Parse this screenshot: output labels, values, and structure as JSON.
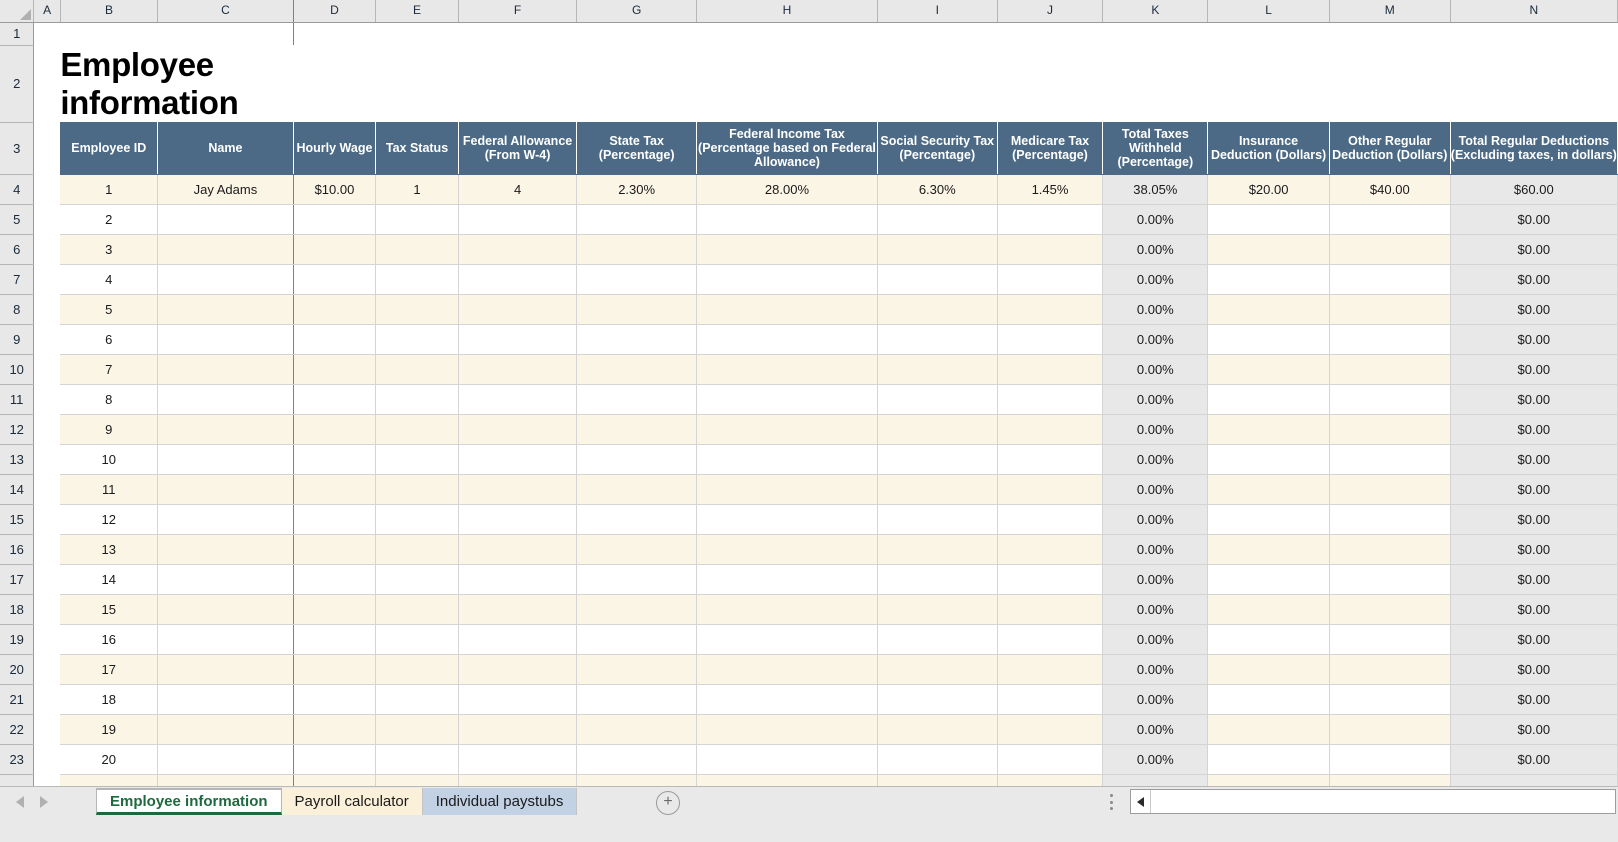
{
  "workbook": {
    "title": "Employee information"
  },
  "grid": {
    "column_letters": [
      "A",
      "B",
      "C",
      "D",
      "E",
      "F",
      "G",
      "H",
      "I",
      "J",
      "K",
      "L",
      "M",
      "N"
    ],
    "row_numbers": [
      "1",
      "2",
      "3",
      "4",
      "5",
      "6",
      "7",
      "8",
      "9",
      "10",
      "11",
      "12",
      "13",
      "14",
      "15",
      "16",
      "17",
      "18",
      "19",
      "20",
      "21",
      "22",
      "23"
    ],
    "corner_icon": "select-all-triangle-icon"
  },
  "sheet_title": "Employee information",
  "table": {
    "headers": [
      "Employee ID",
      "Name",
      "Hourly Wage",
      "Tax  Status",
      "Federal Allowance (From W-4)",
      "State Tax (Percentage)",
      "Federal Income Tax (Percentage based on Federal Allowance)",
      "Social Security Tax (Percentage)",
      "Medicare Tax (Percentage)",
      "Total Taxes Withheld (Percentage)",
      "Insurance Deduction (Dollars)",
      "Other Regular Deduction (Dollars)",
      "Total Regular Deductions (Excluding taxes, in dollars)"
    ],
    "rows": [
      {
        "id": "1",
        "name": "Jay Adams",
        "wage": "$10.00",
        "tax_status": "1",
        "allowance": "4",
        "state_tax": "2.30%",
        "federal_tax": "28.00%",
        "social_security": "6.30%",
        "medicare": "1.45%",
        "total_withheld": "38.05%",
        "insurance": "$20.00",
        "other": "$40.00",
        "total_deductions": "$60.00"
      },
      {
        "id": "2",
        "name": "",
        "wage": "",
        "tax_status": "",
        "allowance": "",
        "state_tax": "",
        "federal_tax": "",
        "social_security": "",
        "medicare": "",
        "total_withheld": "0.00%",
        "insurance": "",
        "other": "",
        "total_deductions": "$0.00"
      },
      {
        "id": "3",
        "name": "",
        "wage": "",
        "tax_status": "",
        "allowance": "",
        "state_tax": "",
        "federal_tax": "",
        "social_security": "",
        "medicare": "",
        "total_withheld": "0.00%",
        "insurance": "",
        "other": "",
        "total_deductions": "$0.00"
      },
      {
        "id": "4",
        "name": "",
        "wage": "",
        "tax_status": "",
        "allowance": "",
        "state_tax": "",
        "federal_tax": "",
        "social_security": "",
        "medicare": "",
        "total_withheld": "0.00%",
        "insurance": "",
        "other": "",
        "total_deductions": "$0.00"
      },
      {
        "id": "5",
        "name": "",
        "wage": "",
        "tax_status": "",
        "allowance": "",
        "state_tax": "",
        "federal_tax": "",
        "social_security": "",
        "medicare": "",
        "total_withheld": "0.00%",
        "insurance": "",
        "other": "",
        "total_deductions": "$0.00"
      },
      {
        "id": "6",
        "name": "",
        "wage": "",
        "tax_status": "",
        "allowance": "",
        "state_tax": "",
        "federal_tax": "",
        "social_security": "",
        "medicare": "",
        "total_withheld": "0.00%",
        "insurance": "",
        "other": "",
        "total_deductions": "$0.00"
      },
      {
        "id": "7",
        "name": "",
        "wage": "",
        "tax_status": "",
        "allowance": "",
        "state_tax": "",
        "federal_tax": "",
        "social_security": "",
        "medicare": "",
        "total_withheld": "0.00%",
        "insurance": "",
        "other": "",
        "total_deductions": "$0.00"
      },
      {
        "id": "8",
        "name": "",
        "wage": "",
        "tax_status": "",
        "allowance": "",
        "state_tax": "",
        "federal_tax": "",
        "social_security": "",
        "medicare": "",
        "total_withheld": "0.00%",
        "insurance": "",
        "other": "",
        "total_deductions": "$0.00"
      },
      {
        "id": "9",
        "name": "",
        "wage": "",
        "tax_status": "",
        "allowance": "",
        "state_tax": "",
        "federal_tax": "",
        "social_security": "",
        "medicare": "",
        "total_withheld": "0.00%",
        "insurance": "",
        "other": "",
        "total_deductions": "$0.00"
      },
      {
        "id": "10",
        "name": "",
        "wage": "",
        "tax_status": "",
        "allowance": "",
        "state_tax": "",
        "federal_tax": "",
        "social_security": "",
        "medicare": "",
        "total_withheld": "0.00%",
        "insurance": "",
        "other": "",
        "total_deductions": "$0.00"
      },
      {
        "id": "11",
        "name": "",
        "wage": "",
        "tax_status": "",
        "allowance": "",
        "state_tax": "",
        "federal_tax": "",
        "social_security": "",
        "medicare": "",
        "total_withheld": "0.00%",
        "insurance": "",
        "other": "",
        "total_deductions": "$0.00"
      },
      {
        "id": "12",
        "name": "",
        "wage": "",
        "tax_status": "",
        "allowance": "",
        "state_tax": "",
        "federal_tax": "",
        "social_security": "",
        "medicare": "",
        "total_withheld": "0.00%",
        "insurance": "",
        "other": "",
        "total_deductions": "$0.00"
      },
      {
        "id": "13",
        "name": "",
        "wage": "",
        "tax_status": "",
        "allowance": "",
        "state_tax": "",
        "federal_tax": "",
        "social_security": "",
        "medicare": "",
        "total_withheld": "0.00%",
        "insurance": "",
        "other": "",
        "total_deductions": "$0.00"
      },
      {
        "id": "14",
        "name": "",
        "wage": "",
        "tax_status": "",
        "allowance": "",
        "state_tax": "",
        "federal_tax": "",
        "social_security": "",
        "medicare": "",
        "total_withheld": "0.00%",
        "insurance": "",
        "other": "",
        "total_deductions": "$0.00"
      },
      {
        "id": "15",
        "name": "",
        "wage": "",
        "tax_status": "",
        "allowance": "",
        "state_tax": "",
        "federal_tax": "",
        "social_security": "",
        "medicare": "",
        "total_withheld": "0.00%",
        "insurance": "",
        "other": "",
        "total_deductions": "$0.00"
      },
      {
        "id": "16",
        "name": "",
        "wage": "",
        "tax_status": "",
        "allowance": "",
        "state_tax": "",
        "federal_tax": "",
        "social_security": "",
        "medicare": "",
        "total_withheld": "0.00%",
        "insurance": "",
        "other": "",
        "total_deductions": "$0.00"
      },
      {
        "id": "17",
        "name": "",
        "wage": "",
        "tax_status": "",
        "allowance": "",
        "state_tax": "",
        "federal_tax": "",
        "social_security": "",
        "medicare": "",
        "total_withheld": "0.00%",
        "insurance": "",
        "other": "",
        "total_deductions": "$0.00"
      },
      {
        "id": "18",
        "name": "",
        "wage": "",
        "tax_status": "",
        "allowance": "",
        "state_tax": "",
        "federal_tax": "",
        "social_security": "",
        "medicare": "",
        "total_withheld": "0.00%",
        "insurance": "",
        "other": "",
        "total_deductions": "$0.00"
      },
      {
        "id": "19",
        "name": "",
        "wage": "",
        "tax_status": "",
        "allowance": "",
        "state_tax": "",
        "federal_tax": "",
        "social_security": "",
        "medicare": "",
        "total_withheld": "0.00%",
        "insurance": "",
        "other": "",
        "total_deductions": "$0.00"
      },
      {
        "id": "20",
        "name": "",
        "wage": "",
        "tax_status": "",
        "allowance": "",
        "state_tax": "",
        "federal_tax": "",
        "social_security": "",
        "medicare": "",
        "total_withheld": "0.00%",
        "insurance": "",
        "other": "",
        "total_deductions": "$0.00"
      }
    ]
  },
  "sheet_tabs": {
    "prev_icon": "previous-sheet-arrow-icon",
    "next_icon": "next-sheet-arrow-icon",
    "add_label": "+",
    "items": [
      {
        "label": "Employee information",
        "active": true,
        "tint": ""
      },
      {
        "label": "Payroll calculator",
        "active": false,
        "tint": "tint-cream"
      },
      {
        "label": "Individual paystubs",
        "active": false,
        "tint": "tint-blue"
      }
    ]
  },
  "colors": {
    "header_blue": "#4c6a85",
    "band_cream": "#fbf5e6",
    "shade_gray": "#e8e8e8",
    "active_tab_green": "#1d6a3e",
    "tab_tint_cream": "#fbf0da",
    "tab_tint_blue": "#c2d2e4"
  }
}
